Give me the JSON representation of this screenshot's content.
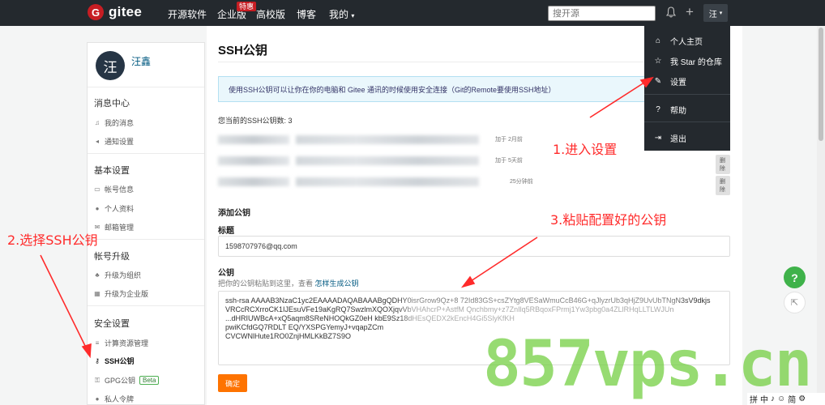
{
  "nav": {
    "logo_letter": "G",
    "logo_text": "gitee",
    "items": [
      "开源软件",
      "企业版",
      "高校版",
      "博客",
      "我的"
    ],
    "hot_badge": "特惠",
    "search_placeholder": "搜开源",
    "avatar_text": "汪",
    "caret": "▾"
  },
  "dropdown": {
    "items": [
      {
        "icon": "home-icon",
        "label": "个人主页"
      },
      {
        "icon": "star-icon",
        "label": "我 Star 的仓库"
      },
      {
        "icon": "edit-icon",
        "label": "设置"
      },
      {
        "icon": "help-icon",
        "label": "帮助"
      },
      {
        "icon": "logout-icon",
        "label": "退出"
      }
    ]
  },
  "sidebar": {
    "avatar_text": "汪",
    "username": "汪鑫",
    "sections": [
      {
        "title": "消息中心",
        "items": [
          "我的消息",
          "通知设置"
        ]
      },
      {
        "title": "基本设置",
        "items": [
          "帐号信息",
          "个人资料",
          "邮箱管理"
        ]
      },
      {
        "title": "帐号升级",
        "items": [
          "升级为组织",
          "升级为企业版"
        ]
      },
      {
        "title": "安全设置",
        "items": [
          "计算资源管理",
          "SSH公钥",
          "GPG公钥",
          "私人令牌"
        ]
      }
    ],
    "beta_label": "Beta"
  },
  "main": {
    "title": "SSH公钥",
    "info": "使用SSH公钥可以让你在你的电脑和 Gitee 通讯的时候使用安全连接（Git的Remote要使用SSH地址）",
    "key_count": "您当前的SSH公钥数: 3",
    "keys": [
      {
        "added": "加于 2月前",
        "delete": ""
      },
      {
        "added": "加于 5天前",
        "delete": "删除"
      },
      {
        "added": "25分钟前",
        "delete": "删除"
      }
    ],
    "add_title": "添加公钥",
    "title_label": "标题",
    "title_value": "1598707976@qq.com",
    "key_label": "公钥",
    "hint": "把你的公钥粘贴到这里，查看",
    "hint_link": "怎样生成公钥",
    "key_lines": [
      "ssh-rsa AAAAB3NzaC1yc2EAAAADAQABAAABgQDHY0isrGrow9Qz+8                 72Id83GS+csZYtg8VESaWmuCcB46G+qJlyzrUb3qHjZ9UvUbTNgN3sV9dkjs",
      "VRCcRCXrroCK1IJEsuVFe19aKgRQ7SwzlmXQOXjqvVbVHAhcrP+AstfM                              Qnchbmy+z7ZnIlq5RBqoxFPrmj1Yw3pbg0a4ZLlRHqLLTLWJUn",
      "                           ...dHRIUWBcA+xQ5aqm8SReNHOQkGZ0eH                                    kbE9Sz18dHEsQEDX2kEncH4Gi5SlyKfKH",
      "pwiKCfdGQ7RDLT                                                    EQ/YXSPGYemyJ+vqapZCm",
      "CVCWNlHute1RO0ZnjHMLKkBZ7S9O"
    ],
    "confirm": "确定"
  },
  "annotations": {
    "step1": "1.进入设置",
    "step2": "2.选择SSH公钥",
    "step3": "3.粘贴配置好的公钥"
  },
  "fab": {
    "help": "?"
  },
  "watermark": "857vps.cn",
  "tray": [
    "拼",
    "中",
    "♪",
    "☺",
    "简",
    "⚙"
  ]
}
